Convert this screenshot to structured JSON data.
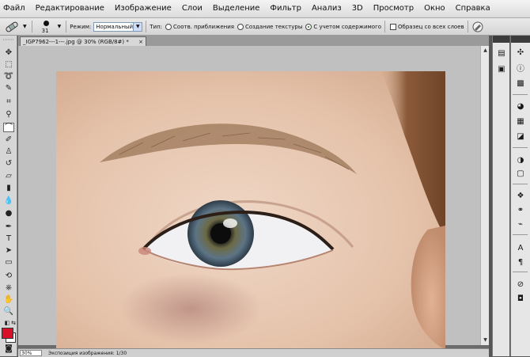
{
  "menu": [
    "Файл",
    "Редактирование",
    "Изображение",
    "Слои",
    "Выделение",
    "Фильтр",
    "Анализ",
    "3D",
    "Просмотр",
    "Окно",
    "Справка"
  ],
  "options": {
    "brush_size": "31",
    "mode_label": "Режим:",
    "mode_value": "Нормальный",
    "type_label": "Тип:",
    "radio_1": "Соотв. приближения",
    "radio_2": "Создание текстуры",
    "radio_3": "С учетом содержимого",
    "checkbox_label": "Образец со всех слоев",
    "selected_type": "С учетом содержимого"
  },
  "document": {
    "tab_title": "_IGP7962---1---.jpg @ 30% (RGB/8#) *",
    "close_glyph": "×"
  },
  "status": {
    "zoom": "30%",
    "text": "Экспозиция изображения: 1/30"
  },
  "colors": {
    "foreground": "#d8102a",
    "background": "#ffffff"
  },
  "tools": [
    "move-icon",
    "marquee-icon",
    "lasso-icon",
    "quick-select-icon",
    "crop-icon",
    "eyedropper-icon",
    "spot-healing-icon",
    "brush-icon",
    "clone-stamp-icon",
    "history-brush-icon",
    "eraser-icon",
    "gradient-icon",
    "blur-icon",
    "dodge-icon",
    "pen-icon",
    "type-icon",
    "path-select-icon",
    "shape-icon",
    "3d-rotate-icon",
    "3d-orbit-icon",
    "hand-icon",
    "zoom-icon"
  ],
  "panels": [
    "history-icon",
    "actions-icon",
    "navigator-icon",
    "info-icon",
    "histogram-icon",
    "color-icon",
    "swatches-icon",
    "styles-icon",
    "adjustments-icon",
    "masks-icon",
    "layers-icon",
    "channels-icon",
    "paths-icon",
    "character-icon",
    "paragraph-icon",
    "clone-source-icon",
    "brushes-icon",
    "3d-icon"
  ]
}
